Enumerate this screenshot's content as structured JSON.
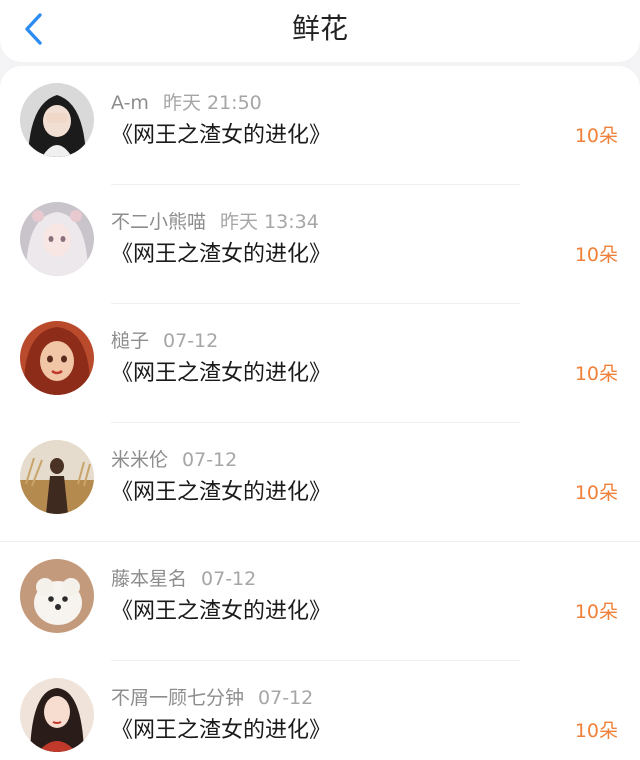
{
  "header": {
    "title": "鲜花",
    "back_icon": "chevron-left-icon",
    "accent_color": "#2d8cf0"
  },
  "list": {
    "items": [
      {
        "user": "A-m",
        "time": "昨天 21:50",
        "book": "《网王之渣女的进化》",
        "amount": "10朵",
        "avatar": "avatar-girl-covering-face"
      },
      {
        "user": "不二小熊喵",
        "time": "昨天 13:34",
        "book": "《网王之渣女的进化》",
        "amount": "10朵",
        "avatar": "avatar-anime-girl-white-hair"
      },
      {
        "user": "槌子",
        "time": "07-12",
        "book": "《网王之渣女的进化》",
        "amount": "10朵",
        "avatar": "avatar-illustrated-red-hair-girl"
      },
      {
        "user": "米米伦",
        "time": "07-12",
        "book": "《网王之渣女的进化》",
        "amount": "10朵",
        "avatar": "avatar-person-in-wheat-field"
      },
      {
        "user": "藤本星名",
        "time": "07-12",
        "book": "《网王之渣女的进化》",
        "amount": "10朵",
        "avatar": "avatar-white-puppy"
      },
      {
        "user": "不屑一顾七分钟",
        "time": "07-12",
        "book": "《网王之渣女的进化》",
        "amount": "10朵",
        "avatar": "avatar-girl-in-red"
      }
    ]
  },
  "colors": {
    "amount": "#f0813a",
    "username": "#8d8d8d",
    "book_title": "#1a1a1a"
  }
}
